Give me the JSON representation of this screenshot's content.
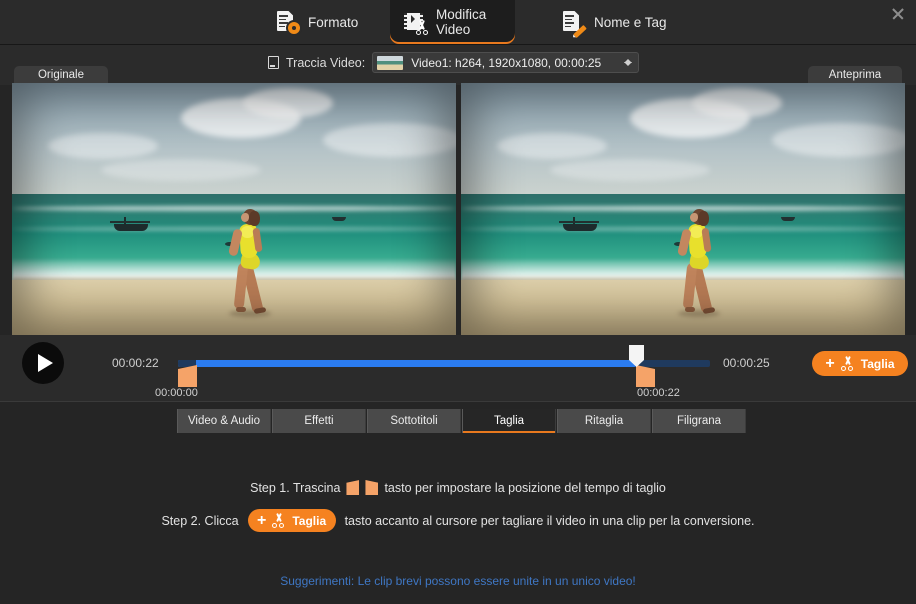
{
  "window": {
    "close_icon": "close-icon"
  },
  "header": {
    "tabs": [
      {
        "label": "Formato",
        "icon": "document-gear-icon",
        "active": false
      },
      {
        "label": "Modifica Video",
        "icon": "film-scissors-icon",
        "active": true
      },
      {
        "label": "Nome e Tag",
        "icon": "document-pencil-icon",
        "active": false
      }
    ]
  },
  "track_bar": {
    "monitor_icon": "monitor-icon",
    "label": "Traccia Video:",
    "selected_value": "Video1: h264, 1920x1080, 00:00:25",
    "caret_icon": "updown-caret-icon"
  },
  "previews": {
    "left_tab": "Originale",
    "right_tab": "Anteprima"
  },
  "timeline": {
    "play_icon": "play-icon",
    "time_start": "00:00:22",
    "time_end": "00:00:25",
    "trim_left_time": "00:00:00",
    "trim_right_time": "00:00:22",
    "cut_button": {
      "label": "Taglia",
      "plus": "+",
      "icon": "scissors-icon"
    }
  },
  "sub_tabs": [
    {
      "label": "Video & Audio",
      "active": false
    },
    {
      "label": "Effetti",
      "active": false
    },
    {
      "label": "Sottotitoli",
      "active": false
    },
    {
      "label": "Taglia",
      "active": true
    },
    {
      "label": "Ritaglia",
      "active": false
    },
    {
      "label": "Filigrana",
      "active": false
    }
  ],
  "instructions": {
    "step1_before": "Step 1. Trascina",
    "step1_after": "tasto per impostare la posizione del tempo di taglio",
    "step2_before": "Step 2. Clicca",
    "step2_button": "Taglia",
    "step2_after": "tasto accanto al cursore per tagliare il video in una clip per la conversione.",
    "tip": "Suggerimenti: Le clip brevi possono essere unite in un unico video!"
  },
  "colors": {
    "accent": "#f58220",
    "progress": "#2b7cf0",
    "trim": "#f5a368",
    "link": "#3f77c4",
    "panel": "#252525",
    "header": "#2b2b2b"
  }
}
